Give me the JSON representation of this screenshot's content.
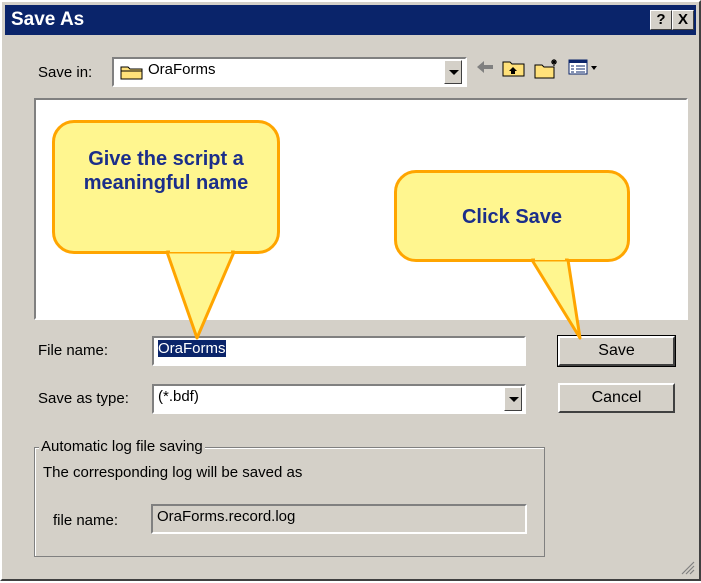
{
  "window": {
    "title": "Save As",
    "help_button": "?",
    "close_button": "X"
  },
  "save_in": {
    "label": "Save in:",
    "folder": "OraForms"
  },
  "file_name": {
    "label": "File name:",
    "value": "OraForms"
  },
  "save_as_type": {
    "label": "Save as type:",
    "value": "(*.bdf)"
  },
  "buttons": {
    "save": "Save",
    "cancel": "Cancel"
  },
  "log_group": {
    "legend": "Automatic log file saving",
    "description": "The corresponding log will be saved as",
    "file_name_label": "file name:",
    "file_name_value": "OraForms.record.log"
  },
  "callouts": {
    "name_tip": "Give the script a meaningful name",
    "save_tip": "Click Save"
  },
  "colors": {
    "title_bar": "#0a246a",
    "dialog_bg": "#d4d0c8",
    "callout_fill": "#fff68f",
    "callout_border": "#ffa500",
    "callout_text": "#1b2e8a",
    "selection": "#0a246a"
  },
  "icons": {
    "folder": "folder-icon",
    "back": "back-arrow-icon",
    "up": "up-folder-icon",
    "new_folder": "new-folder-icon",
    "view": "view-menu-icon"
  }
}
